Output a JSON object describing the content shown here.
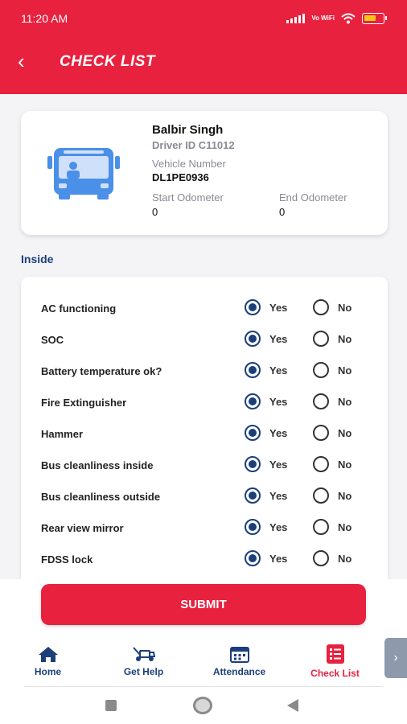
{
  "status_bar": {
    "time": "11:20 AM",
    "network_label": "Vo WiFi"
  },
  "header": {
    "title": "CHECK LIST",
    "back_icon": "chevron-left-icon"
  },
  "driver": {
    "name": "Balbir Singh",
    "driver_id": "Driver ID C11012",
    "vehicle_number_label": "Vehicle Number",
    "vehicle_number": "DL1PE0936",
    "start_odometer_label": "Start Odometer",
    "start_odometer": "0",
    "end_odometer_label": "End Odometer",
    "end_odometer": "0",
    "icon": "bus-icon"
  },
  "section_title": "Inside",
  "options": {
    "yes": "Yes",
    "no": "No"
  },
  "checklist": [
    {
      "label": "AC functioning",
      "selected": "yes"
    },
    {
      "label": "SOC",
      "selected": "yes"
    },
    {
      "label": "Battery temperature ok?",
      "selected": "yes"
    },
    {
      "label": "Fire Extinguisher",
      "selected": "yes"
    },
    {
      "label": "Hammer",
      "selected": "yes"
    },
    {
      "label": "Bus cleanliness inside",
      "selected": "yes"
    },
    {
      "label": "Bus cleanliness outside",
      "selected": "yes"
    },
    {
      "label": "Rear view mirror",
      "selected": "yes"
    },
    {
      "label": "FDSS lock",
      "selected": "yes"
    }
  ],
  "submit_label": "SUBMIT",
  "bottom_nav": [
    {
      "label": "Home",
      "icon": "home-icon",
      "active": false
    },
    {
      "label": "Get Help",
      "icon": "tow-truck-icon",
      "active": false
    },
    {
      "label": "Attendance",
      "icon": "calendar-icon",
      "active": false
    },
    {
      "label": "Check List",
      "icon": "checklist-icon",
      "active": true
    }
  ],
  "colors": {
    "brand_red": "#e8213f",
    "navy": "#1c3f7a",
    "bus_blue": "#4a8fe8"
  }
}
